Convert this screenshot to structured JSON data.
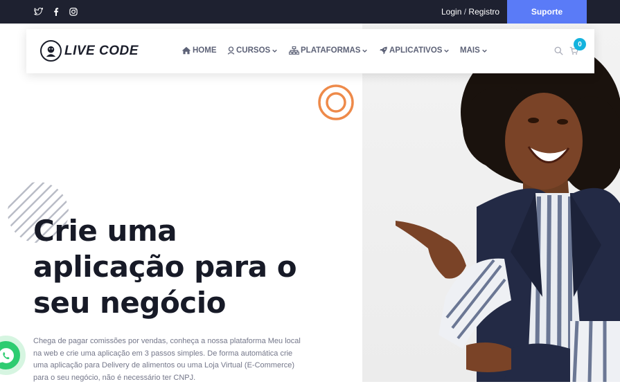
{
  "topbar": {
    "social_icons": [
      "twitter-icon",
      "facebook-icon",
      "instagram-icon"
    ],
    "login_label": "Login",
    "separator": "/",
    "register_label": "Registro",
    "support_label": "Suporte",
    "support_color": "#5a7bf7",
    "background": "#1e2130"
  },
  "navbar": {
    "logo_text": "LIVE CODE",
    "items": [
      {
        "label": "HOME",
        "icon": "home-icon",
        "has_caret": false
      },
      {
        "label": "CURSOS",
        "icon": "user-icon",
        "has_caret": true
      },
      {
        "label": "PLATAFORMAS",
        "icon": "sitemap-icon",
        "has_caret": true
      },
      {
        "label": "APLICATIVOS",
        "icon": "rocket-icon",
        "has_caret": true
      },
      {
        "label": "MAIS",
        "icon": null,
        "has_caret": true
      }
    ],
    "cart_count": "0",
    "cart_badge_color": "#14b3de"
  },
  "hero": {
    "title": "Crie uma aplicação para o seu negócio",
    "description": "Chega de pagar comissões por vendas, conheça a nossa plataforma Meu local na web e crie uma aplicação em 3 passos simples. De forma automática crie uma aplicação para Delivery de alimentos ou uma Loja Virtual (E-Commerce) para o seu negócio, não é necessário ter CNPJ.",
    "accent_ring_color": "#ee8a4a",
    "whatsapp_color": "#2ecc71"
  }
}
